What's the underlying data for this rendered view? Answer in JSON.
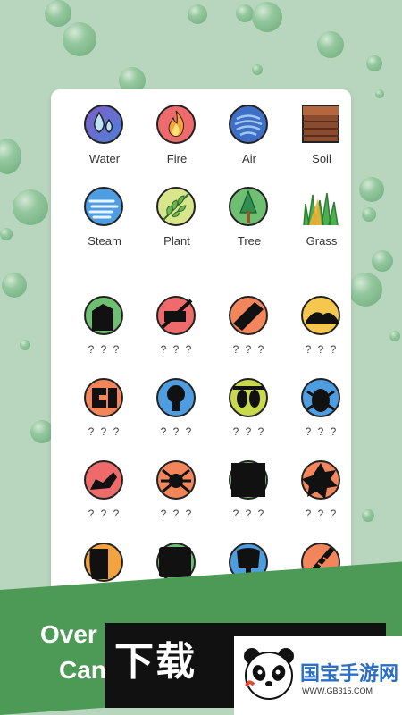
{
  "elements": {
    "discovered": [
      {
        "name": "Water",
        "icon": "water-drops-icon"
      },
      {
        "name": "Fire",
        "icon": "flame-icon"
      },
      {
        "name": "Air",
        "icon": "wind-swirl-icon"
      },
      {
        "name": "Soil",
        "icon": "soil-layers-icon"
      },
      {
        "name": "Steam",
        "icon": "steam-icon"
      },
      {
        "name": "Plant",
        "icon": "leaf-icon"
      },
      {
        "name": "Tree",
        "icon": "tree-icon"
      },
      {
        "name": "Grass",
        "icon": "grass-icon"
      }
    ],
    "locked": [
      {
        "name": "? ? ?",
        "icon": "locked-silhouette-1-icon",
        "color": "#6fbf73"
      },
      {
        "name": "? ? ?",
        "icon": "locked-silhouette-2-icon",
        "color": "#ef6b6b"
      },
      {
        "name": "? ? ?",
        "icon": "locked-silhouette-3-icon",
        "color": "#f2855a"
      },
      {
        "name": "? ? ?",
        "icon": "locked-silhouette-4-icon",
        "color": "#f5c74f"
      },
      {
        "name": "? ? ?",
        "icon": "locked-silhouette-5-icon",
        "color": "#f2855a"
      },
      {
        "name": "? ? ?",
        "icon": "locked-silhouette-6-icon",
        "color": "#4d9de0"
      },
      {
        "name": "? ? ?",
        "icon": "locked-silhouette-7-icon",
        "color": "#c9d94e"
      },
      {
        "name": "? ? ?",
        "icon": "locked-silhouette-8-icon",
        "color": "#4d9de0"
      },
      {
        "name": "? ? ?",
        "icon": "locked-silhouette-9-icon",
        "color": "#ef6b6b"
      },
      {
        "name": "? ? ?",
        "icon": "locked-silhouette-10-icon",
        "color": "#f2855a"
      },
      {
        "name": "? ? ?",
        "icon": "locked-silhouette-11-icon",
        "color": "#6fbf73"
      },
      {
        "name": "? ? ?",
        "icon": "locked-silhouette-12-icon",
        "color": "#f2855a"
      },
      {
        "name": "? ? ?",
        "icon": "locked-silhouette-13-icon",
        "color": "#f2a33f"
      },
      {
        "name": "? ? ?",
        "icon": "locked-silhouette-14-icon",
        "color": "#6fbf73"
      },
      {
        "name": "? ? ?",
        "icon": "locked-silhouette-15-icon",
        "color": "#4d9de0"
      },
      {
        "name": "? ? ?",
        "icon": "locked-silhouette-16-icon",
        "color": "#f2855a"
      }
    ]
  },
  "banner": {
    "line1": "Over",
    "line2": "Can"
  },
  "watermark": {
    "text": "下载",
    "brand": "国宝手游网",
    "url": "WWW.GB315.COM"
  },
  "colors": {
    "background": "#b8d6bd",
    "banner": "#4d9a56",
    "card": "#ffffff"
  }
}
